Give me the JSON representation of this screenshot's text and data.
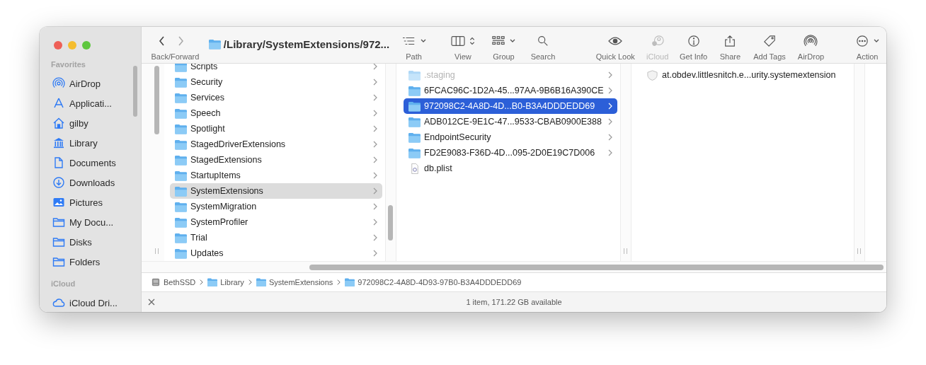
{
  "window": {
    "title": "/Library/SystemExtensions/972..."
  },
  "toolbar": {
    "navigation_label": "Back/Forward",
    "items": [
      {
        "label": "Path",
        "disabled": false
      },
      {
        "label": "View",
        "disabled": false
      },
      {
        "label": "Group",
        "disabled": false
      },
      {
        "label": "Search",
        "disabled": false
      },
      {
        "label": "Quick Look",
        "disabled": false
      },
      {
        "label": "iCloud",
        "disabled": true
      },
      {
        "label": "Get Info",
        "disabled": false
      },
      {
        "label": "Share",
        "disabled": false
      },
      {
        "label": "Add Tags",
        "disabled": false
      },
      {
        "label": "AirDrop",
        "disabled": false
      },
      {
        "label": "Action",
        "disabled": false
      }
    ]
  },
  "sidebar": {
    "sections": [
      {
        "title": "Favorites",
        "items": [
          {
            "label": "AirDrop"
          },
          {
            "label": "Applicati..."
          },
          {
            "label": "gilby"
          },
          {
            "label": "Library"
          },
          {
            "label": "Documents"
          },
          {
            "label": "Downloads"
          },
          {
            "label": "Pictures"
          },
          {
            "label": "My Docu..."
          },
          {
            "label": "Disks"
          },
          {
            "label": "Folders"
          }
        ]
      },
      {
        "title": "iCloud",
        "items": [
          {
            "label": "iCloud Dri..."
          }
        ]
      }
    ]
  },
  "columns": [
    {
      "active": false,
      "items": [
        {
          "name": "Scripts",
          "kind": "folder",
          "selected": false,
          "hidden": false
        },
        {
          "name": "Security",
          "kind": "folder",
          "selected": false,
          "hidden": false
        },
        {
          "name": "Services",
          "kind": "folder",
          "selected": false,
          "hidden": false
        },
        {
          "name": "Speech",
          "kind": "folder",
          "selected": false,
          "hidden": false
        },
        {
          "name": "Spotlight",
          "kind": "folder",
          "selected": false,
          "hidden": false
        },
        {
          "name": "StagedDriverExtensions",
          "kind": "folder",
          "selected": false,
          "hidden": false
        },
        {
          "name": "StagedExtensions",
          "kind": "folder",
          "selected": false,
          "hidden": false
        },
        {
          "name": "StartupItems",
          "kind": "folder",
          "selected": false,
          "hidden": false
        },
        {
          "name": "SystemExtensions",
          "kind": "folder",
          "selected": true,
          "hidden": false
        },
        {
          "name": "SystemMigration",
          "kind": "folder",
          "selected": false,
          "hidden": false
        },
        {
          "name": "SystemProfiler",
          "kind": "folder",
          "selected": false,
          "hidden": false
        },
        {
          "name": "Trial",
          "kind": "folder",
          "selected": false,
          "hidden": false
        },
        {
          "name": "Updates",
          "kind": "folder",
          "selected": false,
          "hidden": false
        }
      ]
    },
    {
      "active": true,
      "items": [
        {
          "name": ".staging",
          "kind": "folder",
          "selected": false,
          "hidden": true
        },
        {
          "name": "6FCAC96C-1D2A-45...97AA-9B6B16A390CE",
          "kind": "folder",
          "selected": false,
          "hidden": false
        },
        {
          "name": "972098C2-4A8D-4D...B0-B3A4DDDEDD69",
          "kind": "folder",
          "selected": true,
          "hidden": false
        },
        {
          "name": "ADB012CE-9E1C-47...9533-CBAB0900E388",
          "kind": "folder",
          "selected": false,
          "hidden": false
        },
        {
          "name": "EndpointSecurity",
          "kind": "folder",
          "selected": false,
          "hidden": false
        },
        {
          "name": "FD2E9083-F36D-4D...095-2D0E19C7D006",
          "kind": "folder",
          "selected": false,
          "hidden": false
        },
        {
          "name": "db.plist",
          "kind": "file",
          "selected": false,
          "hidden": false
        }
      ]
    },
    {
      "items": [
        {
          "name": "at.obdev.littlesnitch.e...urity.systemextension",
          "kind": "extension",
          "selected": false,
          "hidden": false
        }
      ]
    }
  ],
  "path_bar": [
    {
      "label": "BethSSD",
      "kind": "disk"
    },
    {
      "label": "Library",
      "kind": "folder"
    },
    {
      "label": "SystemExtensions",
      "kind": "folder"
    },
    {
      "label": "972098C2-4A8D-4D93-97B0-B3A4DDDEDD69",
      "kind": "folder"
    }
  ],
  "status_bar": {
    "text": "1 item, 171.22 GB available"
  }
}
